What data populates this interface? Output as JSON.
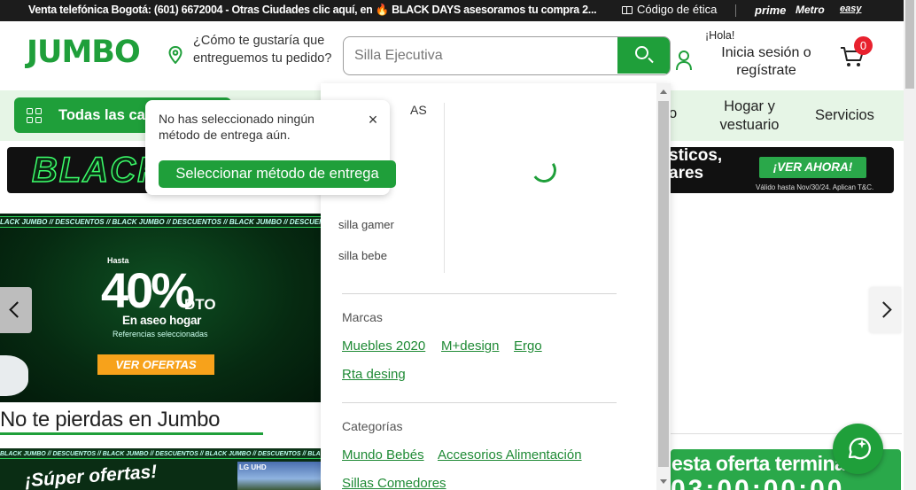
{
  "topbar": {
    "promo_text": "Venta telefónica Bogotá: (601) 6672004 - Otras Ciudades clic aquí, en",
    "promo_flame": "🔥",
    "promo_text2": "BLACK DAYS asesoramos tu compra 2...",
    "ethics_label": "Código de ética",
    "brands": [
      "prime",
      "Metro",
      "easy"
    ]
  },
  "header": {
    "logo": "JUMBO",
    "delivery_question": "¿Cómo te gustaría que entreguemos tu pedido?",
    "search_placeholder": "Silla Ejecutiva",
    "hello": "¡Hola!",
    "login": "Inicia sesión o regístrate",
    "cart_count": "0"
  },
  "nav": {
    "all_categories": "Todas las categorías",
    "partial_item": "o",
    "hogar": "Hogar y vestuario",
    "servicios": "Servicios"
  },
  "black_banner": {
    "word": "BLACK",
    "text_line1": "sticos,",
    "text_line2": "ares",
    "cta": "¡VER AHORA!",
    "valid": "Válido hasta Nov/30/24. Aplican T&C."
  },
  "hero": {
    "strip": "LACK JUMBO // DESCUENTOS // BLACK JUMBO // DESCUENTOS // BLACK JUMBO // DESCUENTOS // BLACK JUMBO",
    "upto": "Hasta",
    "percent": "40%",
    "dto": "DTO",
    "category": "En aseo hogar",
    "refs": "Referencias seleccionadas",
    "cta": "VER OFERTAS"
  },
  "section": {
    "title": "No te pierdas en Jumbo"
  },
  "promo_strip": {
    "strip": "BLACK JUMBO // DESCUENTOS // BLACK JUMBO // DESCUENTOS // BLACK JUMBO // DESCUENTOS // BLACK JUMBO // DESCUENTOS",
    "headline": "¡Súper ofertas!",
    "tv_label": "LG UHD"
  },
  "offer_banner": {
    "title": "esta oferta termina",
    "timer": "03:00:00:00"
  },
  "delivery_popup": {
    "message": "No has seleccionado ningún método de entrega aún.",
    "close": "×",
    "button": "Seleccionar método de entrega"
  },
  "dropdown": {
    "suggestions_header_partial": "AS",
    "suggestions": [
      "silla gamer",
      "silla bebe"
    ],
    "brands_header": "Marcas",
    "brands": [
      "Muebles 2020",
      "M+design",
      "Ergo",
      "Rta desing"
    ],
    "categories_header": "Categorías",
    "categories": [
      "Mundo Bebés",
      "Accesorios Alimentación",
      "Sillas Comedores"
    ]
  },
  "colors": {
    "brand_green": "#1f9f3a",
    "light_green": "#e6f5e6",
    "badge_red": "#e8212e"
  }
}
